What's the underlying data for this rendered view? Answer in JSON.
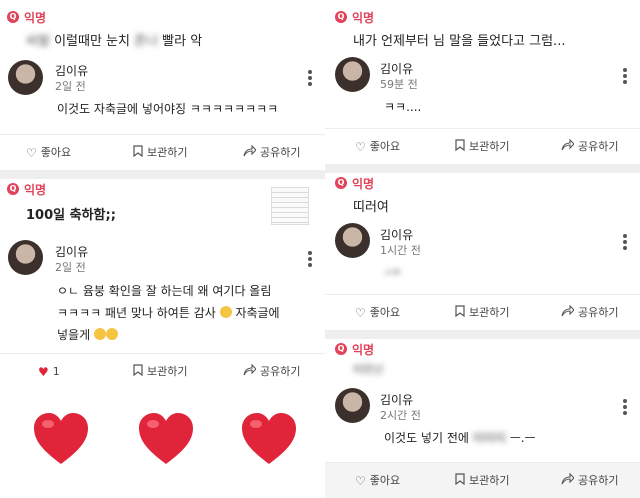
{
  "category_label": "익명",
  "actions": {
    "like": "좋아요",
    "bookmark": "보관하기",
    "share": "공유하기"
  },
  "posts_left": [
    {
      "title_blur_a": "씨발",
      "title_mid": "이럴때만 눈치",
      "title_blur_b": "존나",
      "title_end": "빨라 악",
      "author": "김이유",
      "time": "2일 전",
      "body": [
        "이것도 자축글에 넣어야징 ㅋㅋㅋㅋㅋㅋㅋㅋ"
      ]
    },
    {
      "title": "100일 축하함;;",
      "author": "김이유",
      "time": "2일 전",
      "body": [
        "ㅇㄴ 윰붕 확인을 잘 하는데 왜 여기다 올림",
        "ㅋㅋㅋㅋ 패년 맞나 하여튼 감사",
        "자축글에",
        "넣을게"
      ],
      "like_count": "1"
    }
  ],
  "posts_right": [
    {
      "title": "내가 언제부터 님 말을 들었다고 그럼...",
      "author": "김이유",
      "time": "59분 전",
      "body": "ㅋㅋ...."
    },
    {
      "title": "띠러여",
      "author": "김이유",
      "time": "1시간 전",
      "body_blur": "ㅅㅂ"
    },
    {
      "title_blur": "띠런넌",
      "author": "김이유",
      "time": "2시간 전",
      "body_start": "이것도 넣기 전에",
      "body_blur": "띠띠띠",
      "body_end": "ㅡ.ㅡ"
    }
  ],
  "colors": {
    "accent": "#e0435a",
    "divider": "#eeeeee",
    "heart": "#e0243a"
  }
}
